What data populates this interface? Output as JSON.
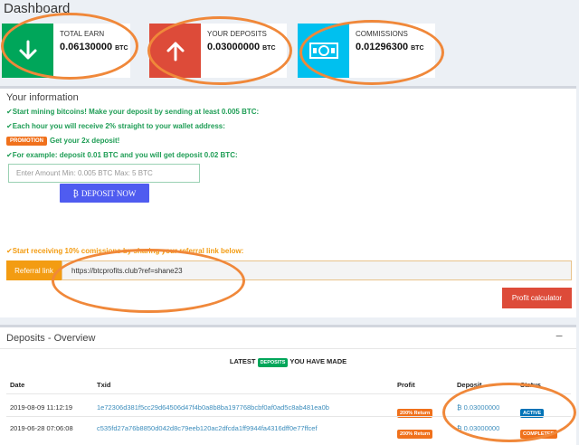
{
  "header": {
    "title": "Dashboard"
  },
  "stats": [
    {
      "label": "TOTAL EARN",
      "value": "0.06130000",
      "unit": "BTC",
      "color": "#00a65a",
      "icon": "arrow-down-icon"
    },
    {
      "label": "YOUR DEPOSITS",
      "value": "0.03000000",
      "unit": "BTC",
      "color": "#dd4b39",
      "icon": "arrow-up-icon"
    },
    {
      "label": "COMMISSIONS",
      "value": "0.01296300",
      "unit": "BTC",
      "color": "#00c0ef",
      "icon": "money-icon"
    }
  ],
  "info": {
    "title": "Your information",
    "line1": "Start mining bitcoins! Make your deposit by sending at least 0.005 BTC:",
    "line2": "Each hour you will receive 2% straight to your wallet address:",
    "promo_badge": "PROMOTION",
    "promo_text": "Get your 2x deposit!",
    "line3": "For example: deposit 0.01 BTC and you will get deposit 0.02 BTC:",
    "amount_placeholder": "Enter Amount  Min: 0.005 BTC Max: 5 BTC",
    "deposit_button": "DEPOSIT NOW",
    "referral_text": "Start receiving 10% comissions by sharing your referral link below:",
    "referral_label": "Referral link",
    "referral_url": "https://btcprofits.club?ref=shane23",
    "profit_calc_button": "Profit calculator"
  },
  "deposits": {
    "title": "Deposits - Overview",
    "collapse_symbol": "−",
    "heading_pre": "LATEST",
    "heading_badge": "DEPOSITS",
    "heading_post": "YOU HAVE MADE",
    "columns": [
      "Date",
      "Txid",
      "Profit",
      "Deposit",
      "Status"
    ],
    "rows": [
      {
        "date": "2019-08-09 11:12:19",
        "txid": "1e72306d381f5cc29d64506d47f4b0a8b8ba197768bcbf0af0ad5c8ab481ea0b",
        "profit": "200% Return",
        "deposit": "0.03000000",
        "status": "ACTIVE"
      },
      {
        "date": "2019-06-28 07:06:08",
        "txid": "c535fd27a76b8850d042d8c79eeb120ac2dfcda1ff9944fa4316dff0e77ffcef",
        "profit": "200% Return",
        "deposit": "0.03000000",
        "status": "COMPLETED"
      }
    ]
  }
}
